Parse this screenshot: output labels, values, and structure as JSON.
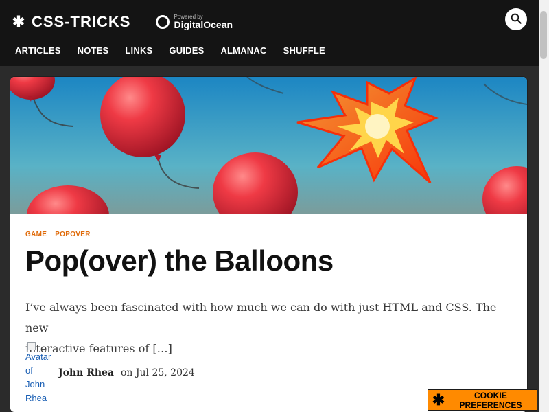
{
  "header": {
    "brand_name": "CSS-TRICKS",
    "powered_by_label": "Powered by",
    "powered_by_brand": "DigitalOcean",
    "icons": {
      "brand": "asterisk-icon",
      "digitalocean": "digitalocean-logo-icon",
      "search": "search-icon"
    },
    "nav": [
      {
        "label": "ARTICLES"
      },
      {
        "label": "NOTES"
      },
      {
        "label": "LINKS"
      },
      {
        "label": "GUIDES"
      },
      {
        "label": "ALMANAC"
      },
      {
        "label": "SHUFFLE"
      }
    ]
  },
  "article": {
    "tags": [
      "GAME",
      "POPOVER"
    ],
    "title": "Pop(over) the Balloons",
    "excerpt_line1": "I’ve always been fascinated with how much we can do with just HTML and CSS. The new",
    "excerpt_line2": "interactive features of […]",
    "author": "John Rhea",
    "on_text": "on Jul 25, 2024",
    "avatar_alt": "Avatar\nof\nJohn\nRhea"
  },
  "cookie_button": {
    "label": "COOKIE PREFERENCES",
    "icon": "asterisk-icon"
  },
  "colors": {
    "page_bg": "#2b2b2b",
    "header_bg": "#141414",
    "accent_tag": "#e06b0a",
    "cookie_bg": "#ff8a00"
  }
}
